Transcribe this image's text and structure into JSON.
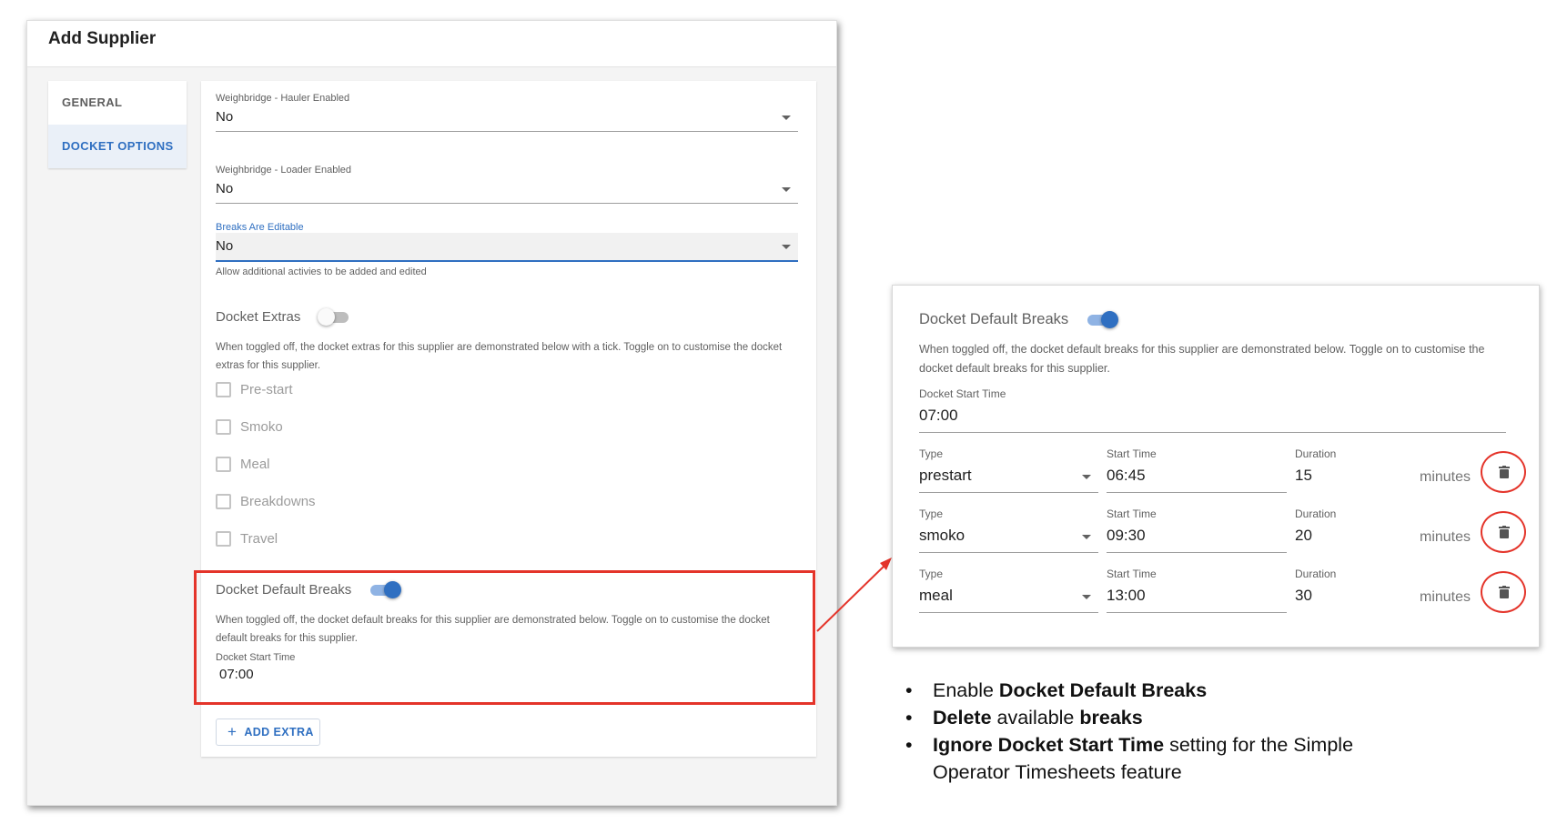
{
  "dialog": {
    "title": "Add Supplier",
    "tabs": [
      {
        "label": "GENERAL",
        "active": false
      },
      {
        "label": "DOCKET OPTIONS",
        "active": true
      }
    ],
    "fields": {
      "hauler": {
        "label": "Weighbridge - Hauler Enabled",
        "value": "No"
      },
      "loader": {
        "label": "Weighbridge - Loader Enabled",
        "value": "No"
      },
      "breaks_editable": {
        "label": "Breaks Are Editable",
        "value": "No",
        "hint": "Allow additional activies to be added and edited"
      }
    },
    "docket_extras": {
      "title": "Docket Extras",
      "enabled": false,
      "description": "When toggled off, the docket extras for this supplier are demonstrated below with a tick. Toggle on to customise the docket extras for this supplier.",
      "items": [
        "Pre-start",
        "Smoko",
        "Meal",
        "Breakdowns",
        "Travel"
      ]
    },
    "docket_default_breaks": {
      "title": "Docket Default Breaks",
      "enabled": true,
      "description": "When toggled off, the docket default breaks for this supplier are demonstrated below. Toggle on to customise the docket default breaks for this supplier.",
      "start_time_label": "Docket Start Time",
      "start_time": "07:00"
    },
    "add_extra_label": "ADD EXTRA"
  },
  "zoom": {
    "title": "Docket Default Breaks",
    "enabled": true,
    "description": "When toggled off, the docket default breaks for this supplier are demonstrated below. Toggle on to customise the docket default breaks for this supplier.",
    "start_time_label": "Docket Start Time",
    "start_time": "07:00",
    "column_labels": {
      "type": "Type",
      "start": "Start Time",
      "duration": "Duration"
    },
    "unit": "minutes",
    "breaks": [
      {
        "type": "prestart",
        "start": "06:45",
        "duration": "15"
      },
      {
        "type": "smoko",
        "start": "09:30",
        "duration": "20"
      },
      {
        "type": "meal",
        "start": "13:00",
        "duration": "30"
      }
    ]
  },
  "notes": [
    {
      "pre": "Enable ",
      "bold": "Docket Default Breaks",
      "post": ""
    },
    {
      "pre": "",
      "bold": "Delete",
      "post": " available ",
      "bold2": "breaks"
    },
    {
      "pre": "",
      "bold": "Ignore Docket Start Time",
      "post": " setting for the Simple Operator Timesheets feature"
    }
  ],
  "colors": {
    "accent": "#2f6fc1",
    "highlight": "#e4342a"
  }
}
